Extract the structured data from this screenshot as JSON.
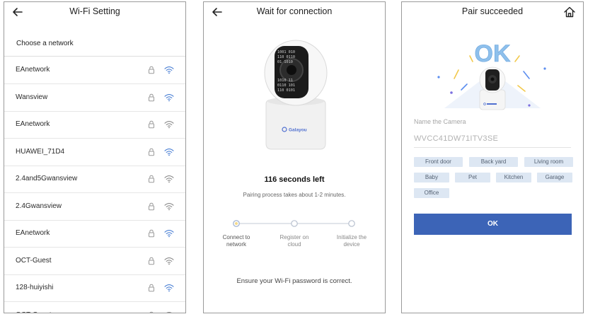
{
  "wifi_setting": {
    "title": "Wi-Fi Setting",
    "section_label": "Choose a network",
    "networks": [
      {
        "name": "EAnetwork",
        "icons": [
          "lock-icon",
          "wifi-icon"
        ],
        "wifi_color": "#4a7fd4"
      },
      {
        "name": "Wansview",
        "icons": [
          "lock-icon",
          "wifi-icon"
        ],
        "wifi_color": "#4a7fd4"
      },
      {
        "name": "EAnetwork",
        "icons": [
          "lock-icon",
          "wifi-icon"
        ],
        "wifi_color": "#8a8a8a"
      },
      {
        "name": "HUAWEI_71D4",
        "icons": [
          "lock-icon",
          "wifi-icon"
        ],
        "wifi_color": "#4a7fd4"
      },
      {
        "name": "2.4and5Gwansview",
        "icons": [
          "lock-icon",
          "wifi-icon"
        ],
        "wifi_color": "#8a8a8a"
      },
      {
        "name": "2.4Gwansview",
        "icons": [
          "lock-icon",
          "wifi-icon"
        ],
        "wifi_color": "#8a8a8a"
      },
      {
        "name": "EAnetwork",
        "icons": [
          "lock-icon",
          "wifi-icon"
        ],
        "wifi_color": "#4a7fd4"
      },
      {
        "name": "OCT-Guest",
        "icons": [
          "lock-icon",
          "wifi-icon"
        ],
        "wifi_color": "#8a8a8a"
      },
      {
        "name": "128-huiyishi",
        "icons": [
          "lock-icon",
          "wifi-icon"
        ],
        "wifi_color": "#4a7fd4"
      },
      {
        "name": "OCT-Guest",
        "icons": [
          "lock-icon",
          "wifi-icon"
        ],
        "wifi_color": "#8a8a8a"
      }
    ]
  },
  "wait_connection": {
    "title": "Wait for connection",
    "camera_brand": "Galayou",
    "countdown": "116 seconds left",
    "pairing_note": "Pairing process takes about 1-2 minutes.",
    "steps": [
      {
        "line1": "Connect to",
        "line2": "network"
      },
      {
        "line1": "Register on",
        "line2": "cloud"
      },
      {
        "line1": "Initialize the",
        "line2": "device"
      }
    ],
    "hint": "Ensure your Wi-Fi password is correct."
  },
  "pair_succeeded": {
    "title": "Pair succeeded",
    "ok_graphic": "OK",
    "field_label": "Name the Camera",
    "camera_name": "WVCC41DW71ITV3SE",
    "name_chips": [
      "Front door",
      "Back yard",
      "Living room",
      "Baby",
      "Pet",
      "Kitchen",
      "Garage",
      "Office"
    ],
    "ok_button": "OK"
  },
  "colors": {
    "accent": "#3c64b7",
    "wifi_active": "#4a7fd4",
    "chip_bg": "#dde7f3",
    "step_circle": "#a9b9d3"
  }
}
